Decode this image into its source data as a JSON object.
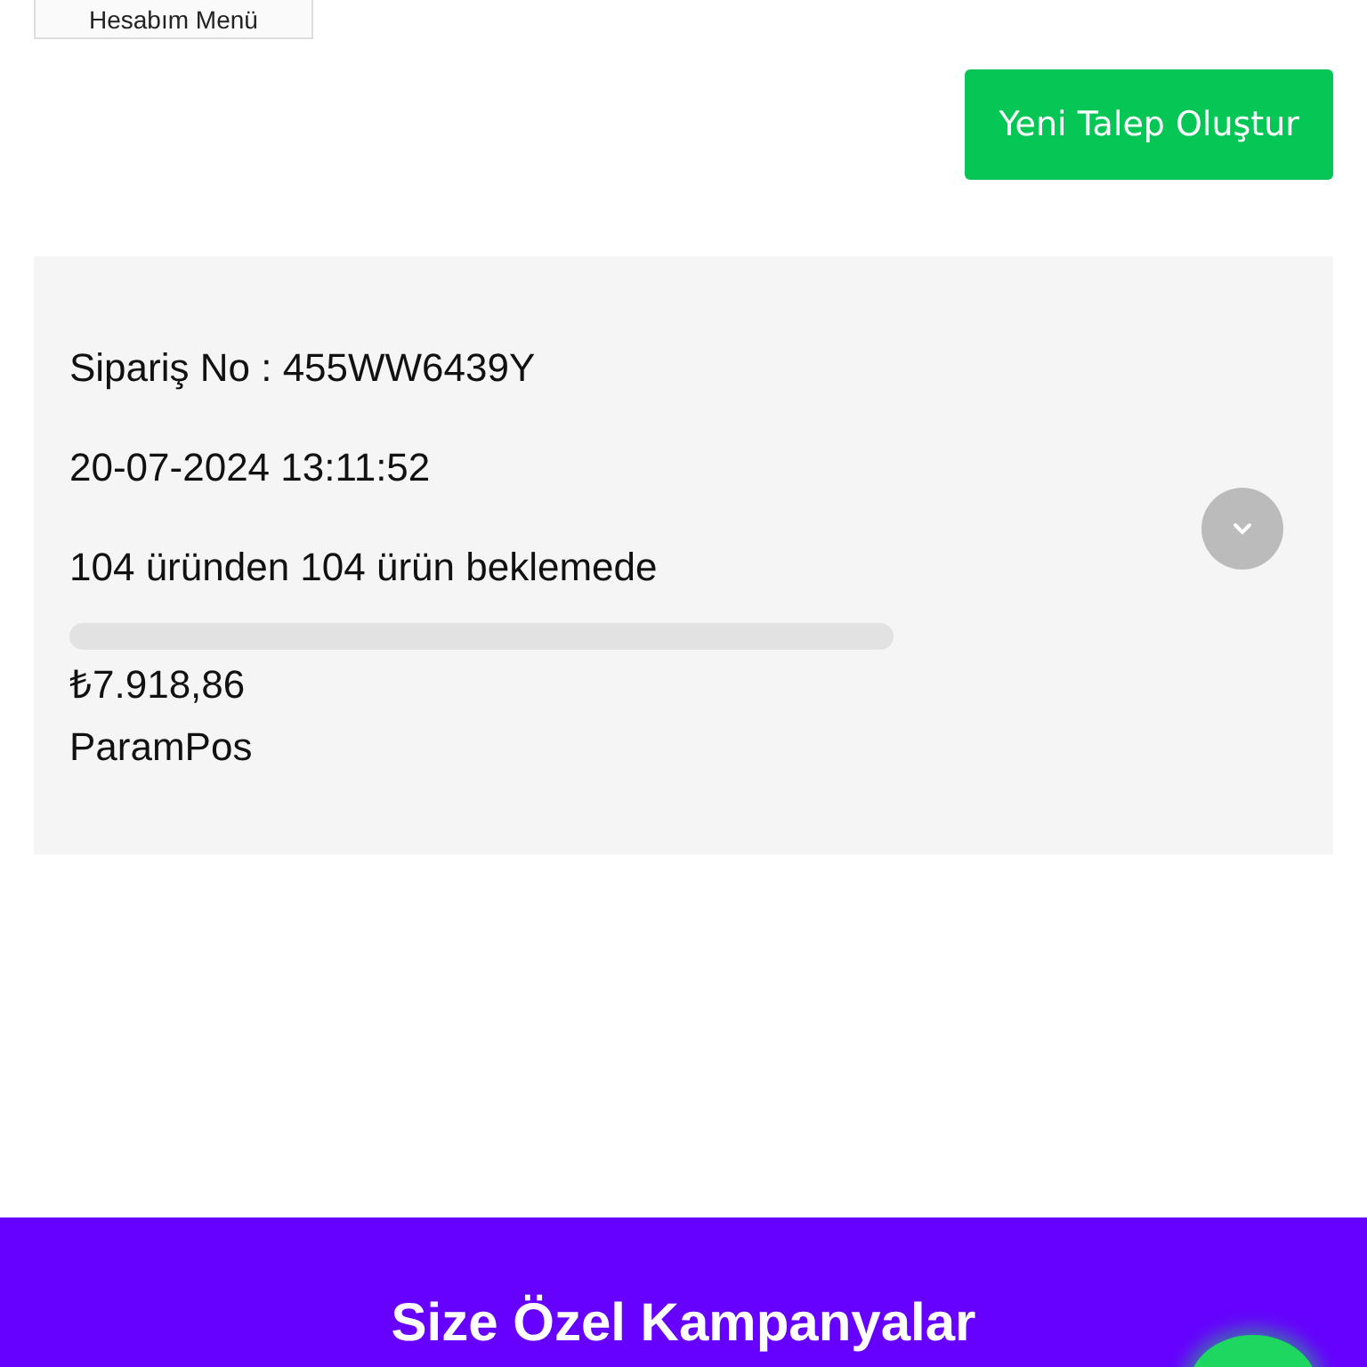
{
  "account_menu_button": {
    "label": "Hesabım Menü"
  },
  "new_request_button": {
    "label": "Yeni Talep Oluştur"
  },
  "order": {
    "order_no": "Sipariş No : 455WW6439Y",
    "date": "20-07-2024 13:11:52",
    "status": "104 üründen 104 ürün beklemede",
    "level": 0,
    "amount": "₺7.918,86",
    "payment": "ParamPos",
    "expanded": false
  },
  "campaign_banner": {
    "title": "Size Özel Kampanyalar"
  }
}
